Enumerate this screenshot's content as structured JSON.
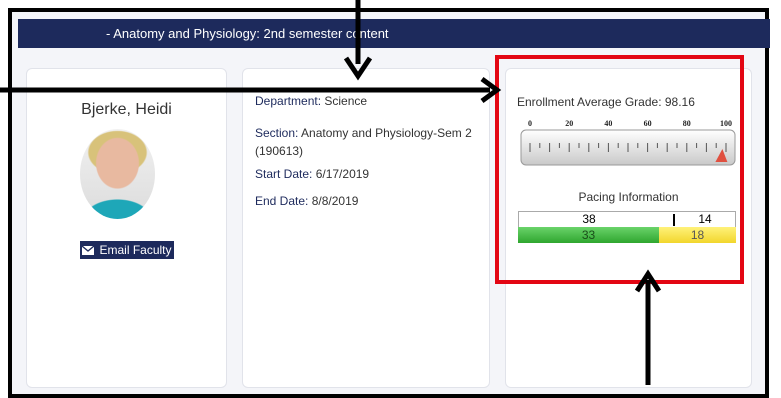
{
  "banner": {
    "title": "- Anatomy and Physiology: 2nd semester content"
  },
  "faculty": {
    "name": "Bjerke, Heidi",
    "email_button_label": "Email Faculty"
  },
  "section_info": {
    "department_label": "Department:",
    "department_value": "Science",
    "section_label": "Section:",
    "section_value": "Anatomy and Physiology-Sem 2 (190613)",
    "start_label": "Start Date:",
    "start_value": "6/17/2019",
    "end_label": "End Date:",
    "end_value": "8/8/2019"
  },
  "grade": {
    "label": "Enrollment Average Grade:",
    "value": "98.16",
    "gauge_value": 98.16,
    "gauge_ticks": [
      "0",
      "20",
      "40",
      "60",
      "80",
      "100"
    ]
  },
  "pacing": {
    "title": "Pacing Information",
    "expected_completed": "38",
    "expected_remaining": "14",
    "actual_completed": "33",
    "actual_remaining": "18"
  },
  "colors": {
    "navy": "#1d2a5c",
    "highlight_red": "#e30613",
    "pace_green": "#2fa62f",
    "pace_yellow": "#f2d62d"
  }
}
